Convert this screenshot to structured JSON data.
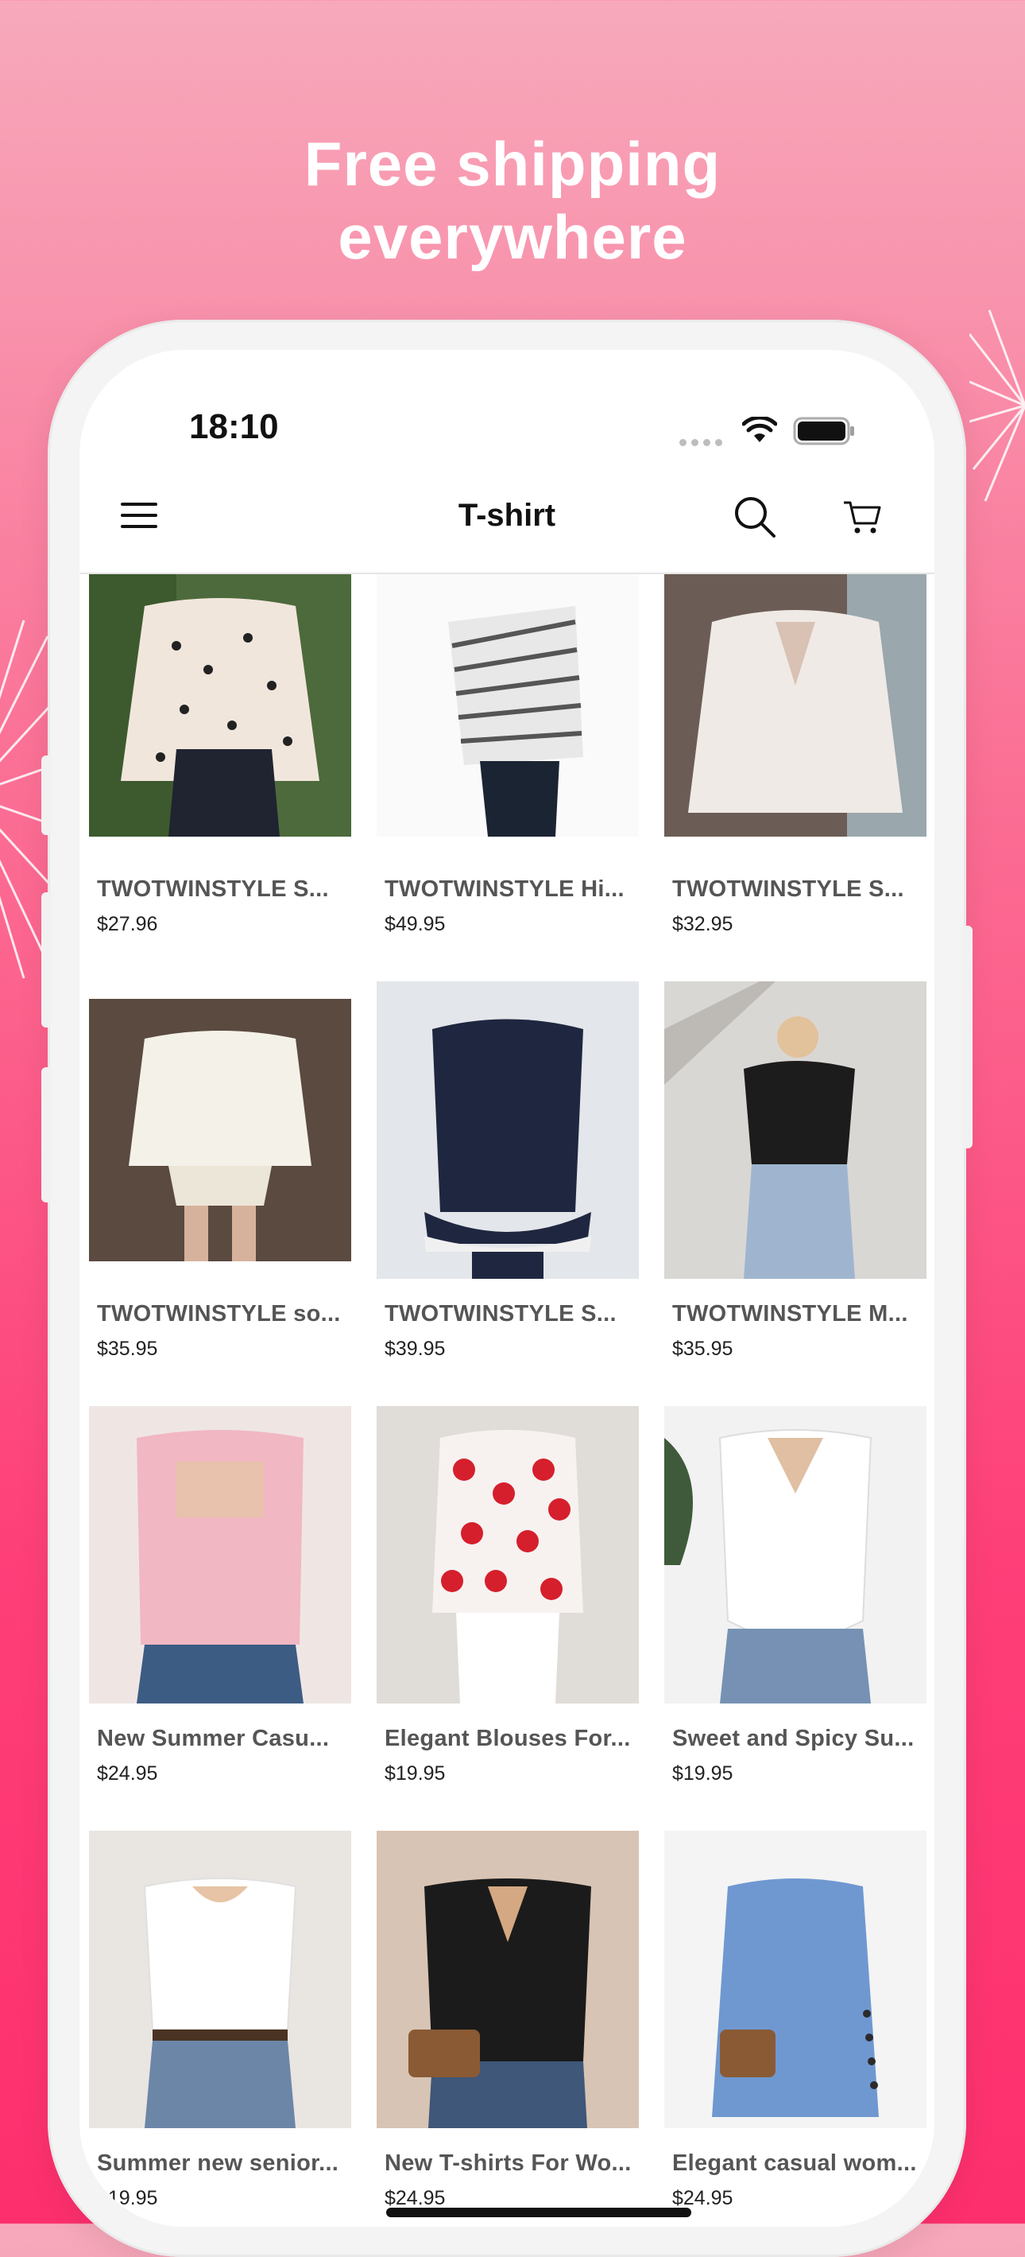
{
  "promo": {
    "line1": "Free shipping",
    "line2": "everywhere"
  },
  "status_bar": {
    "time": "18:10"
  },
  "nav": {
    "title": "T-shirt",
    "menu_icon": "menu-icon",
    "search_icon": "search-icon",
    "cart_icon": "cart-icon"
  },
  "products": [
    {
      "name": "TWOTWINSTYLE S...",
      "price": "$27.96",
      "image": "polka-dot-blouse"
    },
    {
      "name": "TWOTWINSTYLE Hi...",
      "price": "$49.95",
      "image": "striped-off-shoulder-top"
    },
    {
      "name": "TWOTWINSTYLE S...",
      "price": "$32.95",
      "image": "sheer-ruffle-blouse"
    },
    {
      "name": "TWOTWINSTYLE so...",
      "price": "$35.95",
      "image": "cold-shoulder-ruffle-set"
    },
    {
      "name": "TWOTWINSTYLE S...",
      "price": "$39.95",
      "image": "navy-peplum-top"
    },
    {
      "name": "TWOTWINSTYLE M...",
      "price": "$35.95",
      "image": "black-tee-jeans"
    },
    {
      "name": "New Summer Casu...",
      "price": "$24.95",
      "image": "pink-square-neck-top"
    },
    {
      "name": "Elegant Blouses For...",
      "price": "$19.95",
      "image": "heart-print-blouse"
    },
    {
      "name": "Sweet and Spicy Su...",
      "price": "$19.95",
      "image": "white-v-neck-top"
    },
    {
      "name": "Summer new senior...",
      "price": "$19.95",
      "image": "white-scoop-tee"
    },
    {
      "name": "New T-shirts For Wo...",
      "price": "$24.95",
      "image": "black-hooded-tee"
    },
    {
      "name": "Elegant casual wom...",
      "price": "$24.95",
      "image": "blue-button-tunic"
    }
  ],
  "colors": {
    "accent": "#fd2f6d",
    "name_text": "#555555",
    "price_text": "#222222"
  }
}
